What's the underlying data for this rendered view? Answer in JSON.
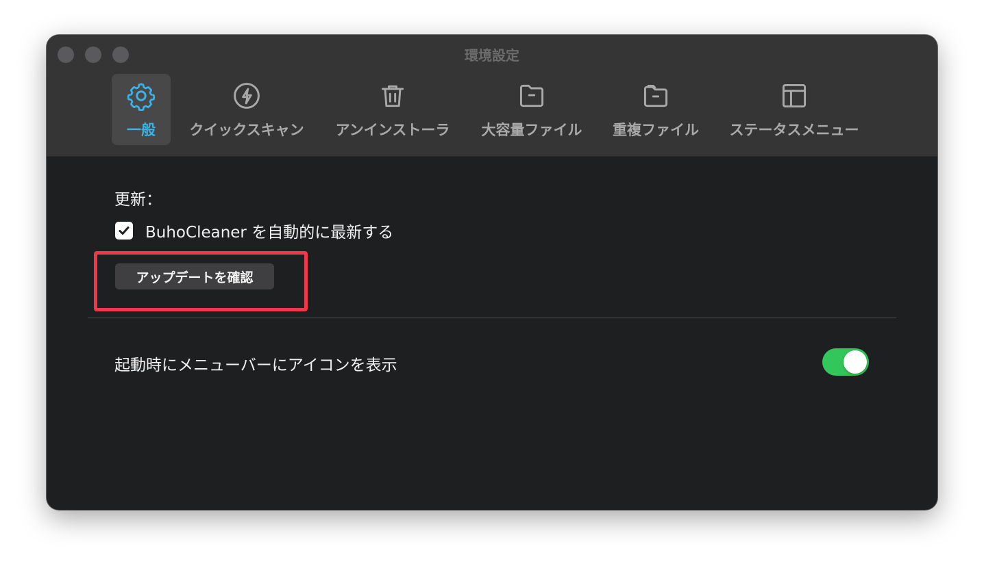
{
  "window": {
    "title": "環境設定"
  },
  "tabs": [
    {
      "label": "一般",
      "icon": "gear-icon",
      "active": true
    },
    {
      "label": "クイックスキャン",
      "icon": "lightning-icon",
      "active": false
    },
    {
      "label": "アンインストーラ",
      "icon": "trash-icon",
      "active": false
    },
    {
      "label": "大容量ファイル",
      "icon": "folder-icon",
      "active": false
    },
    {
      "label": "重複ファイル",
      "icon": "folder-stack-icon",
      "active": false
    },
    {
      "label": "ステータスメニュー",
      "icon": "layout-icon",
      "active": false
    }
  ],
  "update": {
    "section_title": "更新：",
    "auto_update_label": "BuhoCleaner を自動的に最新する",
    "auto_update_checked": true,
    "check_button_label": "アップデートを確認"
  },
  "menubar": {
    "label": "起動時にメニューバーにアイコンを表示",
    "enabled": true
  },
  "colors": {
    "accent": "#3cb2e6",
    "toggle_on": "#33c65a",
    "highlight": "#f0384a"
  }
}
